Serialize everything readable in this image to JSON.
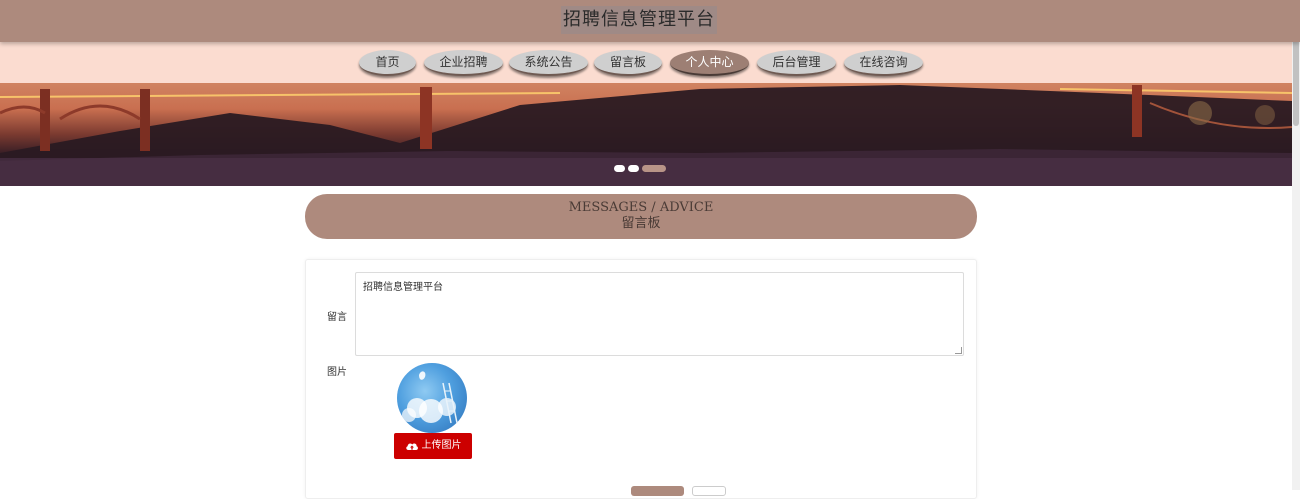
{
  "header": {
    "title": "招聘信息管理平台"
  },
  "nav": {
    "items": [
      {
        "label": "首页",
        "active": false
      },
      {
        "label": "企业招聘",
        "active": false
      },
      {
        "label": "系统公告",
        "active": false
      },
      {
        "label": "留言板",
        "active": false
      },
      {
        "label": "个人中心",
        "active": true
      },
      {
        "label": "后台管理",
        "active": false
      },
      {
        "label": "在线咨询",
        "active": false
      }
    ]
  },
  "banner": {
    "slides": 3,
    "active_slide": 3
  },
  "section": {
    "title_en": "MESSAGES / ADVICE",
    "title_cn": "留言板"
  },
  "form": {
    "message_label": "留言",
    "message_value": "招聘信息管理平台",
    "image_label": "图片",
    "upload_button": "上传图片",
    "upload_icon": "cloud-upload-icon"
  },
  "colors": {
    "header_bg": "#ad8a7d",
    "nav_bg": "#fbdcd0",
    "nav_active": "#9d7f74",
    "upload_button": "#cc0000"
  }
}
